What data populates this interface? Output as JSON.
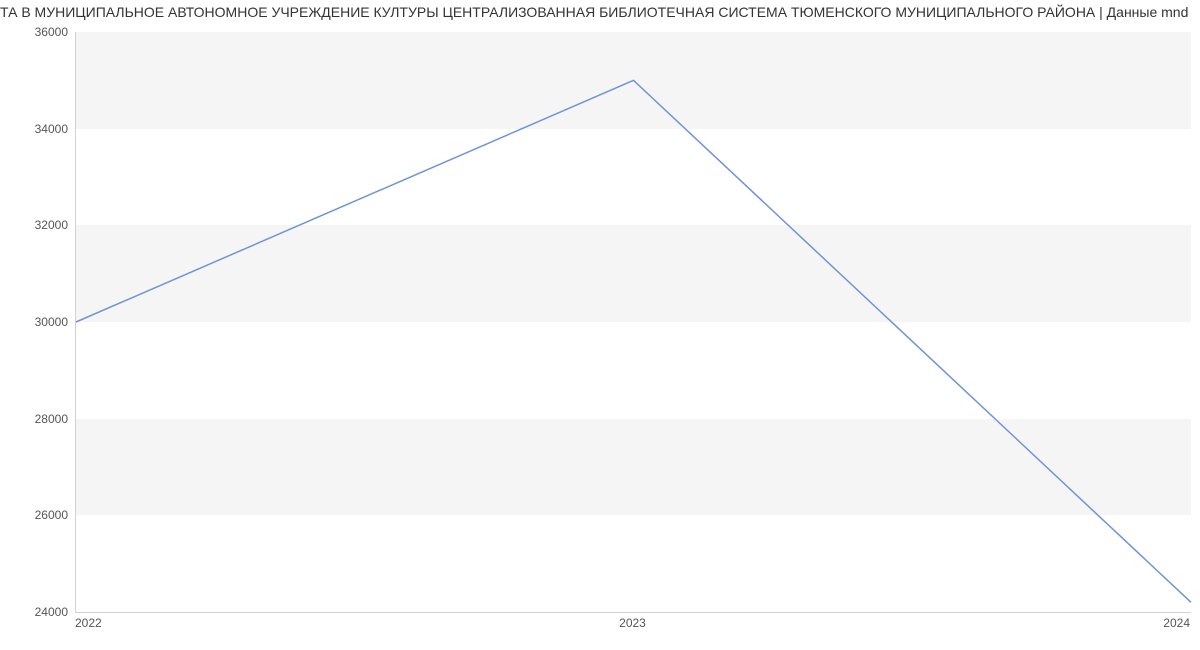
{
  "chart_data": {
    "type": "line",
    "title": "ТА В МУНИЦИПАЛЬНОЕ АВТОНОМНОЕ УЧРЕЖДЕНИЕ КУЛТУРЫ ЦЕНТРАЛИЗОВАННАЯ БИБЛИОТЕЧНАЯ СИСТЕМА ТЮМЕНСКОГО МУНИЦИПАЛЬНОГО РАЙОНА | Данные mnd",
    "xlabel": "",
    "ylabel": "",
    "x": [
      2022,
      2023,
      2024
    ],
    "values": [
      30000,
      35000,
      24200
    ],
    "x_ticks": [
      "2022",
      "2023",
      "2024"
    ],
    "y_ticks": [
      24000,
      26000,
      28000,
      30000,
      32000,
      34000,
      36000
    ],
    "ylim": [
      24000,
      36000
    ],
    "xlim": [
      2022,
      2024
    ],
    "grid": "y-bands"
  }
}
